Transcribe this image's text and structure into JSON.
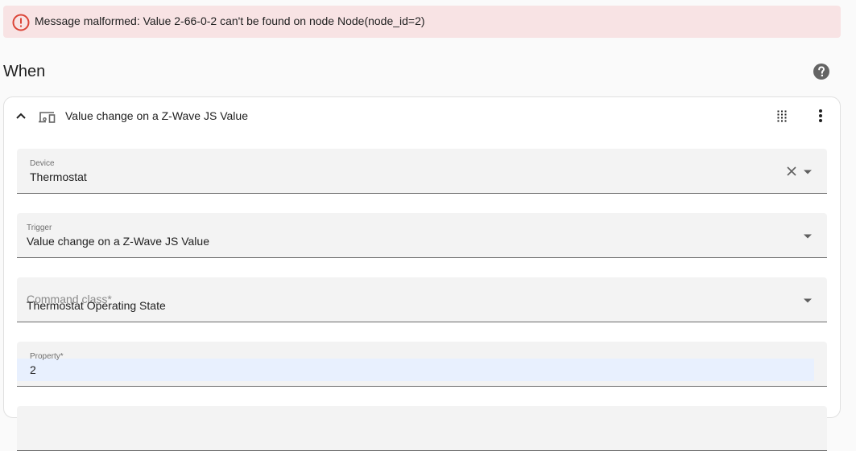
{
  "alert": {
    "message": "Message malformed: Value 2-66-0-2 can't be found on node Node(node_id=2)",
    "icon": "alert-circle-outline",
    "color": "#db4437"
  },
  "section": {
    "title": "When",
    "help_icon": "help-circle"
  },
  "trigger_card": {
    "title": "Value change on a Z-Wave JS Value",
    "icons": [
      "chevron-up",
      "devices",
      "drag",
      "dots-vertical"
    ],
    "fields": {
      "device": {
        "label": "Device",
        "value": "Thermostat"
      },
      "trigger": {
        "label": "Trigger",
        "value": "Value change on a Z-Wave JS Value"
      },
      "command_class": {
        "label": "Command class*",
        "value": "Thermostat Operating State"
      },
      "property": {
        "label": "Property*",
        "value": "2"
      }
    }
  }
}
